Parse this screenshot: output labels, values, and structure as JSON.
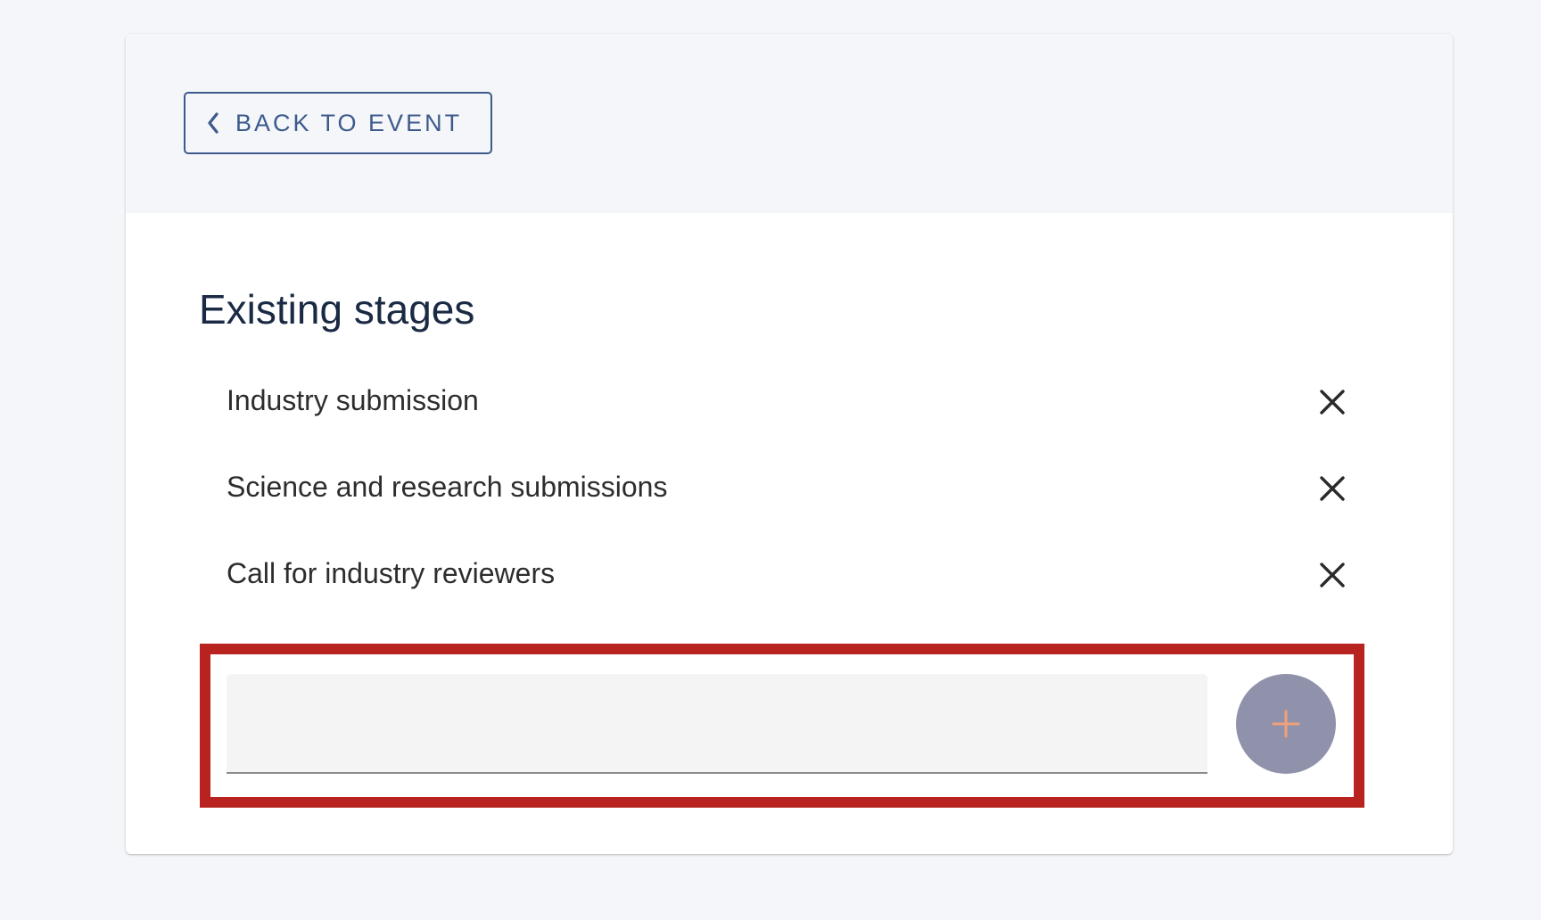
{
  "header": {
    "back_button_label": "BACK TO EVENT",
    "back_icon": "chevron-left-icon"
  },
  "main": {
    "title": "Existing stages",
    "stages": [
      {
        "label": "Industry submission",
        "remove_icon": "close-icon"
      },
      {
        "label": "Science and research submissions",
        "remove_icon": "close-icon"
      },
      {
        "label": "Call for industry reviewers",
        "remove_icon": "close-icon"
      }
    ],
    "new_stage": {
      "value": "",
      "placeholder": "",
      "add_icon": "plus-icon"
    }
  },
  "colors": {
    "page_background": "#f5f6f9",
    "card_background": "#ffffff",
    "accent": "#3c5a8c",
    "title_text": "#1b2a44",
    "add_button": "#9092ab",
    "add_icon": "#f0a07a",
    "highlight": "#b8231f"
  }
}
